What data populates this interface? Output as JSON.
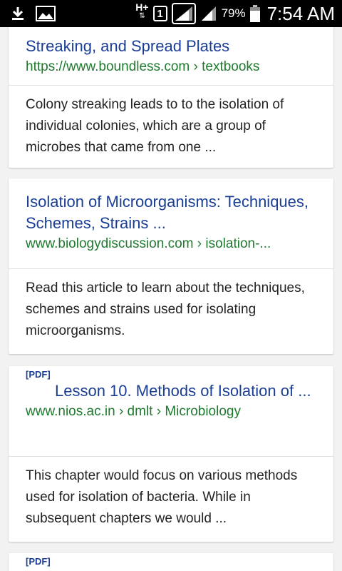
{
  "status_bar": {
    "network_type": "H+",
    "sim_slot": "1",
    "battery_percent": "79%",
    "time": "7:54 AM",
    "icons": [
      "download-icon",
      "image-icon",
      "network-arrows-icon",
      "signal-icon",
      "battery-icon"
    ]
  },
  "results": [
    {
      "title": "Streaking, and Spread Plates",
      "url": "https://www.boundless.com › textbooks",
      "snippet": "Colony streaking leads to to the isolation of individual colonies, which are a group of microbes that came from one ..."
    },
    {
      "title": "Isolation of Microorganisms: Techniques, Schemes, Strains ...",
      "url": "www.biologydiscussion.com › isolation-...",
      "snippet": "Read this article to learn about the techniques, schemes and strains used for isolating microorganisms."
    },
    {
      "tag": "[PDF]",
      "title": "Lesson 10. Methods of Isolation of ...",
      "url": "www.nios.ac.in › dmlt › Microbiology",
      "snippet": "This chapter would focus on various methods used for isolation of bacteria. While in subsequent chapters we would ..."
    },
    {
      "tag": "[PDF]"
    }
  ],
  "colors": {
    "title": "#1a3e96",
    "url": "#1e7a2e",
    "snippet": "#222222",
    "background": "#f2f2f2"
  }
}
